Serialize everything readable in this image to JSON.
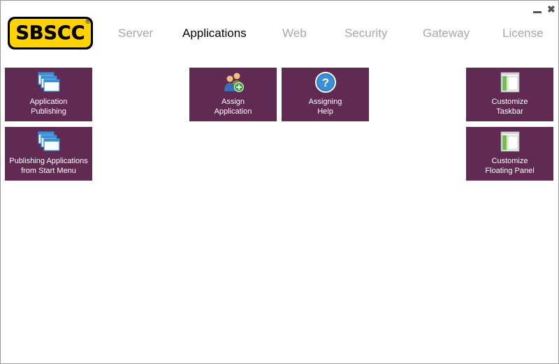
{
  "logo": {
    "text": "SBSCC",
    "reg": "®"
  },
  "window": {
    "minimize_label": "",
    "close_label": "✖"
  },
  "nav": {
    "tabs": [
      {
        "label": "Server"
      },
      {
        "label": "Applications"
      },
      {
        "label": "Web"
      },
      {
        "label": "Security"
      },
      {
        "label": "Gateway"
      },
      {
        "label": "License"
      }
    ],
    "active": "Applications"
  },
  "tiles": {
    "application_publishing": {
      "label": "Application\nPublishing",
      "icon": "windows-stack-icon"
    },
    "publishing_start_menu": {
      "label": "Publishing Applications\nfrom Start Menu",
      "icon": "windows-stack-icon"
    },
    "assign_application": {
      "label": "Assign\nApplication",
      "icon": "users-add-icon"
    },
    "assigning_help": {
      "label": "Assigning\nHelp",
      "icon": "help-icon"
    },
    "customize_taskbar": {
      "label": "Customize\nTaskbar",
      "icon": "taskbar-icon"
    },
    "customize_floating_panel": {
      "label": "Customize\nFloating Panel",
      "icon": "floating-panel-icon"
    }
  },
  "colors": {
    "tile_bg": "#602a52",
    "nav_inactive": "#a8a8a8",
    "nav_active": "#000000",
    "logo_yellow": "#ffd200"
  }
}
